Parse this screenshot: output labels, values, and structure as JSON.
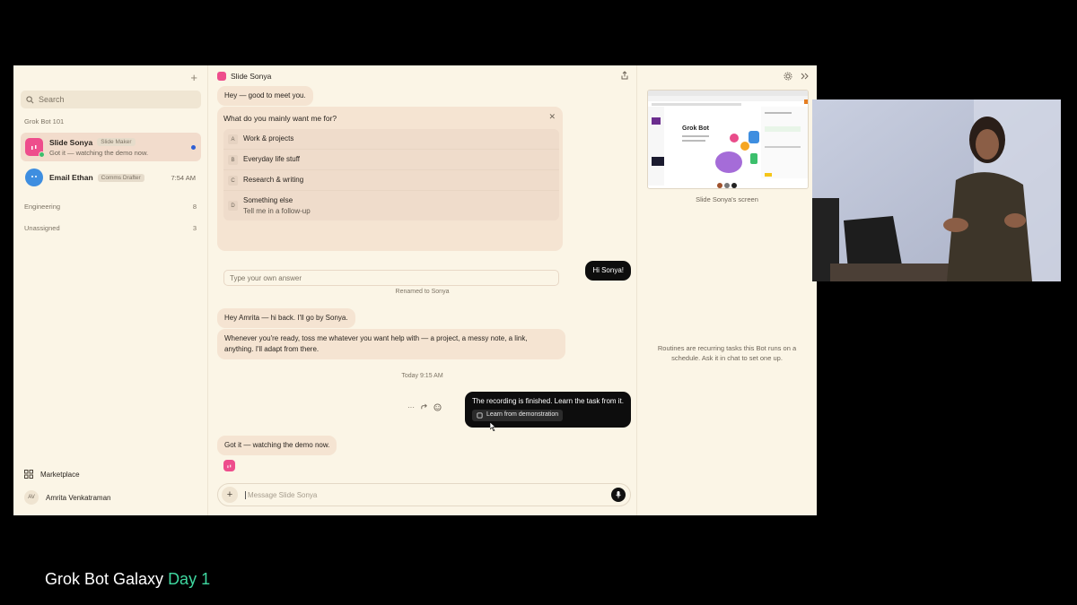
{
  "sidebar": {
    "search_placeholder": "Search",
    "group_main": "Grok Bot 101",
    "chats": [
      {
        "name": "Slide Sonya",
        "tag": "Slide Maker",
        "preview": "Got it — watching the demo now."
      },
      {
        "name": "Email Ethan",
        "tag": "Comms Drafter",
        "time": "7:54 AM"
      }
    ],
    "groups": [
      {
        "label": "Engineering",
        "count": "8"
      },
      {
        "label": "Unassigned",
        "count": "3"
      }
    ],
    "marketplace_label": "Marketplace",
    "user_initials": "AV",
    "user_name": "Amrita Venkatraman"
  },
  "chat": {
    "title": "Slide Sonya",
    "greeting": "Hey — good to meet you.",
    "question": {
      "title": "What do you mainly want me for?",
      "options": [
        {
          "key": "A",
          "label": "Work & projects"
        },
        {
          "key": "B",
          "label": "Everyday life stuff"
        },
        {
          "key": "C",
          "label": "Research & writing"
        },
        {
          "key": "D",
          "label": "Something else",
          "sub": "Tell me in a follow-up"
        }
      ],
      "input_placeholder": "Type your own answer"
    },
    "user_msg_1": "Hi Sonya!",
    "system_rename": "Renamed to Sonya",
    "bot_msg_1": "Hey Amrita — hi back. I'll go by Sonya.",
    "bot_msg_2": "Whenever you're ready, toss me whatever you want help with — a project, a messy note, a link, anything. I'll adapt from there.",
    "timestamp": "Today 9:15 AM",
    "user_msg_2": "The recording is finished. Learn the task from it.",
    "learn_chip": "Learn from demonstration",
    "bot_msg_3": "Got it — watching the demo now.",
    "composer_placeholder": "Message Slide Sonya"
  },
  "right_panel": {
    "screen_caption": "Slide Sonya's screen",
    "thumb_title": "Grok Bot",
    "routines_note": "Routines are recurring tasks this Bot runs on a schedule. Ask it in chat to set one up."
  },
  "branding": {
    "main": "Grok Bot Galaxy",
    "accent": "Day 1",
    "accent_color": "#3fd8a0"
  }
}
